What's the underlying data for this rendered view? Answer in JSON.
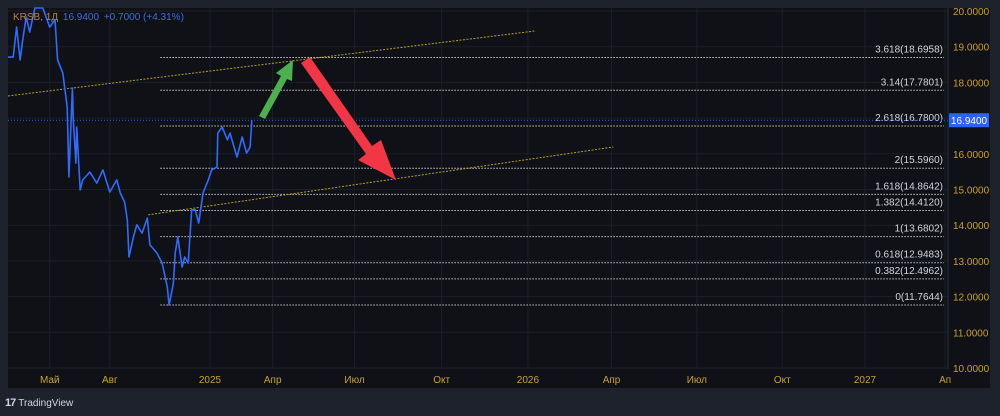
{
  "legend": {
    "symbol": "KRSB, 1Д",
    "price": "16.9400",
    "change": "+0.7000 (+4.31%)"
  },
  "footer": {
    "brand": "TradingView",
    "logo": "17"
  },
  "colors": {
    "line": "#2f6bff",
    "axis_text": "#c9a227",
    "fib": "#c8c8c8",
    "trend": "#b5a22a",
    "badge": "#2962ff",
    "up_arrow": "#4caf50",
    "down_arrow": "#f23645"
  },
  "chart_data": {
    "type": "line",
    "symbol": "KRSB",
    "interval": "1Д",
    "x_unit": "days relative to 2025 start (bar scale)",
    "xlim": [
      -232,
      853
    ],
    "ylim": [
      10,
      20
    ],
    "grid": true,
    "y_ticks": [
      "10.0000",
      "11.0000",
      "12.0000",
      "13.0000",
      "14.0000",
      "15.0000",
      "16.0000",
      "17.0000",
      "18.0000",
      "19.0000",
      "20.0000"
    ],
    "x_ticks": [
      {
        "label": "Май",
        "x": -184
      },
      {
        "label": "Авг",
        "x": -115
      },
      {
        "label": "2025",
        "x": 0
      },
      {
        "label": "Апр",
        "x": 72
      },
      {
        "label": "Июл",
        "x": 166
      },
      {
        "label": "Окт",
        "x": 266
      },
      {
        "label": "2026",
        "x": 365
      },
      {
        "label": "Апр",
        "x": 461
      },
      {
        "label": "Июл",
        "x": 559
      },
      {
        "label": "Окт",
        "x": 657
      },
      {
        "label": "2027",
        "x": 752
      },
      {
        "label": "Ап",
        "x": 844
      }
    ],
    "series": [
      {
        "name": "KRSB",
        "x": [
          -232,
          -226,
          -222,
          -218,
          -215,
          -211,
          -207,
          -201,
          -192,
          -184,
          -178,
          -175,
          -169,
          -164,
          -162,
          -158,
          -157,
          -154,
          -153,
          -149,
          -146,
          -138,
          -130,
          -123,
          -115,
          -107,
          -103,
          -98,
          -95,
          -93,
          -88,
          -84,
          -78,
          -72,
          -69,
          -61,
          -55,
          -49,
          -47,
          -42,
          -40,
          -37,
          -32,
          -29,
          -25,
          -21,
          -17,
          -13,
          -8,
          -2,
          2,
          8,
          9,
          14,
          20,
          23,
          31,
          37,
          42,
          46,
          48
        ],
        "y": [
          18.71,
          18.71,
          19.55,
          18.63,
          19.19,
          19.83,
          19.41,
          20.17,
          20.17,
          19.55,
          19.75,
          18.63,
          18.26,
          17.31,
          15.35,
          17.84,
          16.95,
          15.74,
          16.75,
          14.99,
          15.27,
          15.49,
          15.18,
          15.55,
          14.93,
          15.27,
          14.9,
          14.65,
          14.15,
          13.11,
          13.67,
          14.01,
          13.78,
          14.2,
          13.45,
          13.22,
          12.94,
          12.27,
          11.76,
          12.38,
          13.22,
          13.67,
          12.83,
          13.11,
          12.94,
          14.43,
          14.43,
          14.06,
          14.9,
          15.27,
          15.55,
          15.63,
          16.58,
          16.75,
          16.39,
          16.58,
          15.91,
          16.47,
          16.02,
          16.19,
          16.94
        ]
      }
    ],
    "last_price": {
      "value": 16.94,
      "label": "16.9400"
    },
    "fib_levels": [
      {
        "label": "3.618(18.6958)",
        "value": 18.6958
      },
      {
        "label": "3.14(17.7801)",
        "value": 17.7801
      },
      {
        "label": "2.618(16.7800)",
        "value": 16.78
      },
      {
        "label": "2(15.5960)",
        "value": 15.596
      },
      {
        "label": "1.618(14.8642)",
        "value": 14.8642
      },
      {
        "label": "1.382(14.4120)",
        "value": 14.412
      },
      {
        "label": "1(13.6802)",
        "value": 13.6802
      },
      {
        "label": "0.618(12.9483)",
        "value": 12.9483
      },
      {
        "label": "0.382(12.4962)",
        "value": 12.4962
      },
      {
        "label": "0(11.7644)",
        "value": 11.7644
      }
    ],
    "fib_start_x": -57,
    "trendlines": [
      {
        "name": "upper",
        "x": [
          -232,
          373
        ],
        "y": [
          17.62,
          19.44
        ]
      },
      {
        "name": "lower",
        "x": [
          -71,
          463
        ],
        "y": [
          14.29,
          16.19
        ]
      }
    ]
  }
}
